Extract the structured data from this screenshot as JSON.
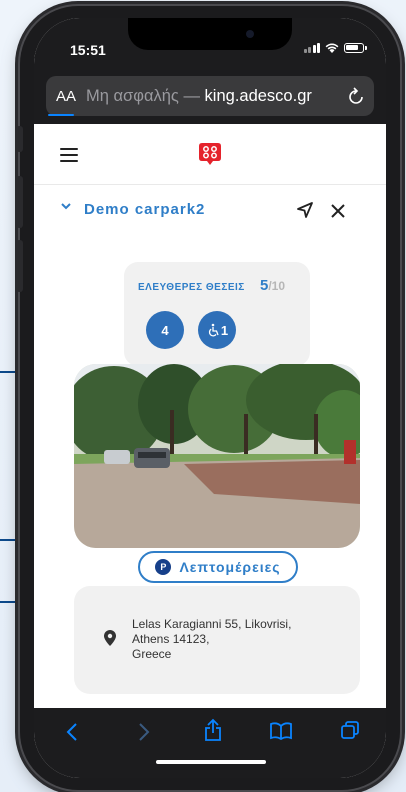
{
  "status": {
    "time": "15:51"
  },
  "browser": {
    "aa": "AA",
    "insecure_label": "Μη ασφαλής —",
    "domain": "king.adesco.gr"
  },
  "carpark": {
    "name": "Demo carpark2",
    "free_label": "ΕΛΕΥΘΕΡΕΣ ΘΕΣΕΙΣ",
    "free_count": "5",
    "total": "/10",
    "regular_spots": "4",
    "accessible_spots": "1",
    "details_label": "Λεπτομέρειες",
    "details_badge": "P",
    "address_lines": [
      "Lelas Karagianni 55, Likovrisi,",
      "Athens 14123,",
      "Greece"
    ]
  },
  "colors": {
    "accent": "#2f7ec8",
    "circle": "#2e6fb8",
    "ios_blue": "#0a84ff"
  }
}
